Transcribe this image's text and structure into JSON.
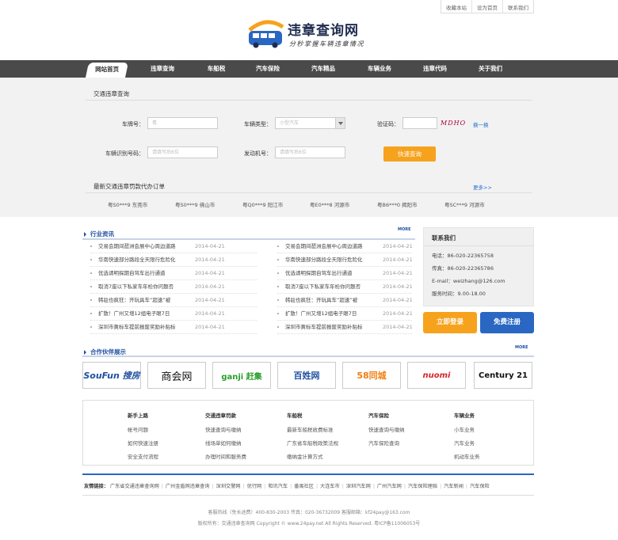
{
  "top_links": [
    "收藏本站",
    "设为首页",
    "联系我们"
  ],
  "logo": {
    "title": "违章查询网",
    "slogan": "分秒掌握车辆违章情况"
  },
  "nav": [
    {
      "label": "网站首页",
      "active": true
    },
    {
      "label": "违章查询"
    },
    {
      "label": "车船税"
    },
    {
      "label": "汽车保险"
    },
    {
      "label": "汽车精品"
    },
    {
      "label": "车辆业务"
    },
    {
      "label": "违章代码"
    },
    {
      "label": "关于我们"
    }
  ],
  "query": {
    "title": "交通违章查询",
    "plate_label": "车牌号：",
    "plate_value": "粤",
    "type_label": "车辆类型：",
    "type_value": "小型汽车",
    "captcha_label": "验证码：",
    "captcha_image_text": "MDHO",
    "refresh_label": "换一换",
    "vin_label": "车辆识别号码：",
    "vin_placeholder": "请填写后6位",
    "engine_label": "发动机号：",
    "engine_placeholder": "请填写后6位",
    "submit_label": "快速查询"
  },
  "orders": {
    "title": "最新交通违章罚款代办订单",
    "more": "更多>>",
    "items": [
      "粤S0***9 东莞市",
      "粤S0***9 佛山市",
      "粤Q0***9 阳江市",
      "粤E0***8 河源市",
      "粤B6***0 揭阳市",
      "粤SC***9 河源市"
    ]
  },
  "news": {
    "title": "行业资讯",
    "more": "MORE",
    "items": [
      {
        "title": "交易会期间琶洲会展中心周边道路",
        "date": "2014-04-21"
      },
      {
        "title": "交易会期间琶洲会展中心周边道路",
        "date": "2014-04-21"
      },
      {
        "title": "华南快速部分路段全天限行危险化",
        "date": "2014-04-21"
      },
      {
        "title": "华南快速部分路段全天限行危险化",
        "date": "2014-04-21"
      },
      {
        "title": "优选请明探期自驾车出行通道",
        "date": "2014-04-21"
      },
      {
        "title": "优选请明探期自驾车出行通道",
        "date": "2014-04-21"
      },
      {
        "title": "取消7座以下私家车年检你问题否",
        "date": "2014-04-21"
      },
      {
        "title": "取消7座以下私家车年检你问题否",
        "date": "2014-04-21"
      },
      {
        "title": "韩驻也疯狂：开玩具车“超速”被",
        "date": "2014-04-21"
      },
      {
        "title": "韩驻也疯狂：开玩具车“超速”被",
        "date": "2014-04-21"
      },
      {
        "title": "扩散！广州又增12组电子眼7日",
        "date": "2014-04-21"
      },
      {
        "title": "扩散！广州又增12组电子眼7日",
        "date": "2014-04-21"
      },
      {
        "title": "深圳市黄标车提前报废奖励补贴标",
        "date": "2014-04-21"
      },
      {
        "title": "深圳市黄标车提前报废奖励补贴标",
        "date": "2014-04-21"
      }
    ]
  },
  "contact": {
    "title": "联系我们",
    "phone": "电话：86-020-22365758",
    "fax": "传真：86-020-22365786",
    "email": "E-mail：weizhang@126.com",
    "hours": "服务时间：9.00-18.00"
  },
  "buttons": {
    "login": "立即登录",
    "register": "免费注册"
  },
  "partners": {
    "title": "合作伙伴展示",
    "more": "MORE",
    "logos": [
      "SouFun 搜房",
      "商会网",
      "ganji 赶集",
      "百姓网",
      "58同城",
      "nuomi",
      "Century 21"
    ]
  },
  "help": [
    {
      "heading": "新手上路",
      "links": [
        "帐号问题",
        "如何快速注册",
        "安全支付流程"
      ]
    },
    {
      "heading": "交通违章罚款",
      "links": [
        "快速查询与缴纳",
        "线场单如何缴纳",
        "办理时间和服务费"
      ]
    },
    {
      "heading": "车船税",
      "links": [
        "最新车船税收费标准",
        "广东省车船税政策法规",
        "缴纳金计算方式"
      ]
    },
    {
      "heading": "汽车保险",
      "links": [
        "快速查询与缴纳",
        "汽车保险查询"
      ]
    },
    {
      "heading": "车辆业务",
      "links": [
        "小车业务",
        "汽车业务",
        "机动车业务"
      ]
    }
  ],
  "friends": {
    "label": "友情链接：",
    "links": [
      "广东省交通违章查询网",
      "广州金盾网违章查询",
      "深圳交警网",
      "优行网",
      "和讯汽车",
      "番禺社区",
      "大连车市",
      "深圳汽车网",
      "广州汽车网",
      "汽车保险理赔",
      "汽车新闻",
      "汽车保险"
    ]
  },
  "footer": {
    "line1": "客服热线（免长途费）400-830-2003  传真：020-36732009  客服邮箱：kf24pay@163.com",
    "line2": "版权所有：交通违章查询网  Copyright © www.24pay.net All Rights Reserved. 粤ICP备11006053号"
  },
  "colors": {
    "nav_bg": "#4a4a4a",
    "accent_orange": "#f7a21d",
    "accent_blue": "#2967c3",
    "section_title": "#1f4fa0"
  }
}
